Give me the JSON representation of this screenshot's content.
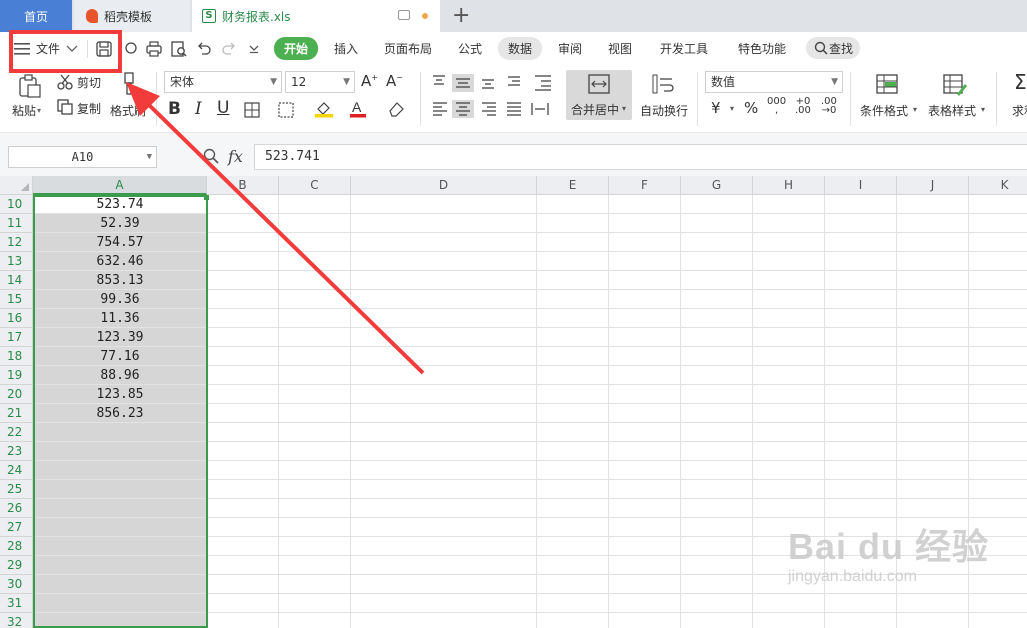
{
  "tabs": [
    {
      "label": "首页"
    },
    {
      "label": "稻壳模板"
    },
    {
      "label": "财务报表.xls"
    }
  ],
  "menu": {
    "file_label": "文件",
    "items": [
      "开始",
      "插入",
      "页面布局",
      "公式",
      "数据",
      "审阅",
      "视图",
      "开发工具",
      "特色功能"
    ],
    "search_label": "查找"
  },
  "ribbon": {
    "paste": "粘贴",
    "cut": "剪切",
    "copy": "复制",
    "format_painter": "格式刷",
    "font_name": "宋体",
    "font_size": "12",
    "merge_center": "合并居中",
    "auto_wrap": "自动换行",
    "number_format": "数值",
    "currency_symbol": "¥",
    "percent_symbol": "%",
    "cond_format": "条件格式",
    "table_style": "表格样式",
    "sum_label": "求和"
  },
  "formula_bar": {
    "name_box": "A10",
    "fx_label": "fx",
    "formula": "523.741"
  },
  "grid": {
    "columns": [
      "A",
      "B",
      "C",
      "D",
      "E",
      "F",
      "G",
      "H",
      "I",
      "J",
      "K"
    ],
    "rows": [
      "10",
      "11",
      "12",
      "13",
      "14",
      "15",
      "16",
      "17",
      "18",
      "19",
      "20",
      "21",
      "22",
      "23",
      "24",
      "25",
      "26",
      "27",
      "28",
      "29",
      "30",
      "31",
      "32"
    ],
    "column_a_values": [
      "523.74",
      "52.39",
      "754.57",
      "632.46",
      "853.13",
      "99.36",
      "11.36",
      "123.39",
      "77.16",
      "88.96",
      "123.85",
      "856.23"
    ]
  },
  "watermark": {
    "brand": "Bai du 经验",
    "url": "jingyan.baidu.com"
  },
  "colors": {
    "accent_green": "#4caf50",
    "selection_border": "#3a9b4a",
    "annotation_red": "#f23b3b",
    "home_tab_blue": "#4a7fd6"
  }
}
